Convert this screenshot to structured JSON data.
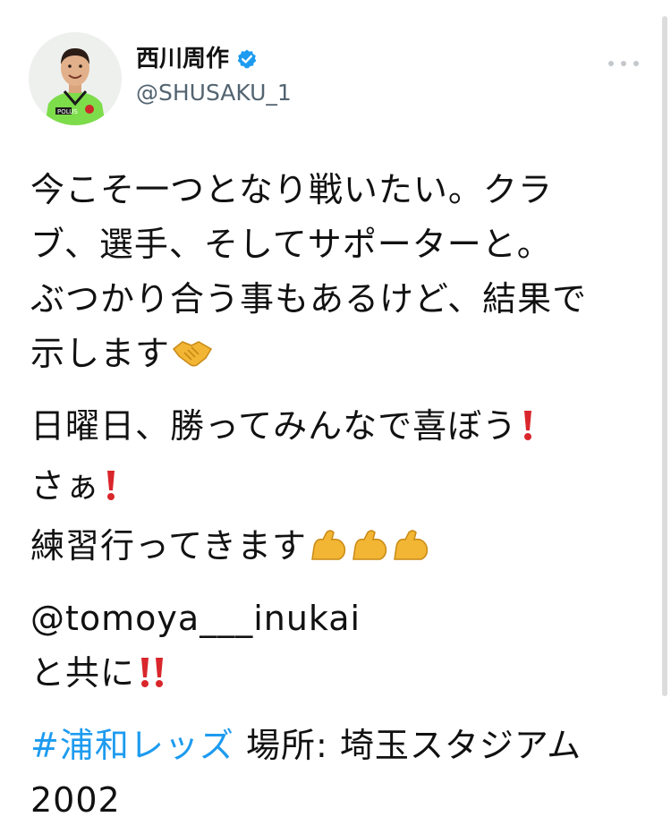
{
  "profile": {
    "display_name": "西川周作",
    "handle": "@SHUSAKU_1",
    "verified_icon": "verified-badge-icon",
    "avatar_icon": "avatar-photo",
    "shirt_text": "POLUS"
  },
  "menu": {
    "more_icon": "more-options-icon"
  },
  "tweet": {
    "line1": "今こそ一つとなり戦いたい。クラ",
    "line2": "ブ、選手、そしてサポーターと。",
    "line3": "ぶつかり合う事もあるけど、結果で",
    "line4": "示します",
    "line5": "日曜日、勝ってみんなで喜ぼう",
    "line6": "さぁ",
    "line7": "練習行ってきます",
    "mention": "@tomoya___inukai",
    "line9": "と共に",
    "hashtag": "#浦和レッズ",
    "location": "場所: 埼玉スタジアム",
    "location_year": "2002"
  },
  "colors": {
    "link": "#1d9bf0",
    "handle": "#536471",
    "exclamation": "#d9262c",
    "muscle": "#f2b534",
    "verified": "#1d9bf0"
  }
}
